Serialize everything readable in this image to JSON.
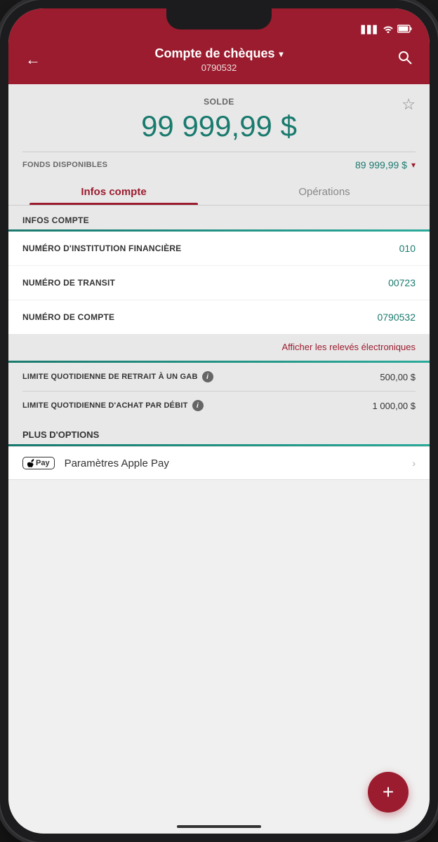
{
  "statusBar": {
    "signal": "▋▋▋",
    "wifi": "wifi",
    "battery": "battery"
  },
  "header": {
    "backLabel": "←",
    "title": "Compte de chèques",
    "accountNumber": "0790532",
    "searchLabel": "⌕",
    "dropdownArrow": "▾"
  },
  "balance": {
    "label": "SOLDE",
    "amount": "99 999,99 $",
    "starIcon": "☆"
  },
  "fonds": {
    "label": "FONDS DISPONIBLES",
    "value": "89 999,99 $",
    "chevron": "▾"
  },
  "tabs": [
    {
      "id": "infos",
      "label": "Infos compte",
      "active": true
    },
    {
      "id": "operations",
      "label": "Opérations",
      "active": false
    }
  ],
  "sectionHeader": "INFOS COMPTE",
  "infoRows": [
    {
      "label": "NUMÉRO D'INSTITUTION FINANCIÈRE",
      "value": "010"
    },
    {
      "label": "NUMÉRO DE TRANSIT",
      "value": "00723"
    },
    {
      "label": "NUMÉRO DE COMPTE",
      "value": "0790532"
    }
  ],
  "electronicLink": "Afficher les relevés électroniques",
  "limits": [
    {
      "label": "LIMITE QUOTIDIENNE DE RETRAIT À UN GAB",
      "value": "500,00 $",
      "hasInfo": true
    },
    {
      "label": "LIMITE QUOTIDIENNE D'ACHAT PAR DÉBIT",
      "value": "1 000,00 $",
      "hasInfo": true
    }
  ],
  "optionsHeader": "PLUS D'OPTIONS",
  "applePay": {
    "badgeText": "Pay",
    "appleSymbol": "",
    "label": "Paramètres Apple Pay",
    "chevron": "›"
  },
  "fab": {
    "label": "+"
  }
}
